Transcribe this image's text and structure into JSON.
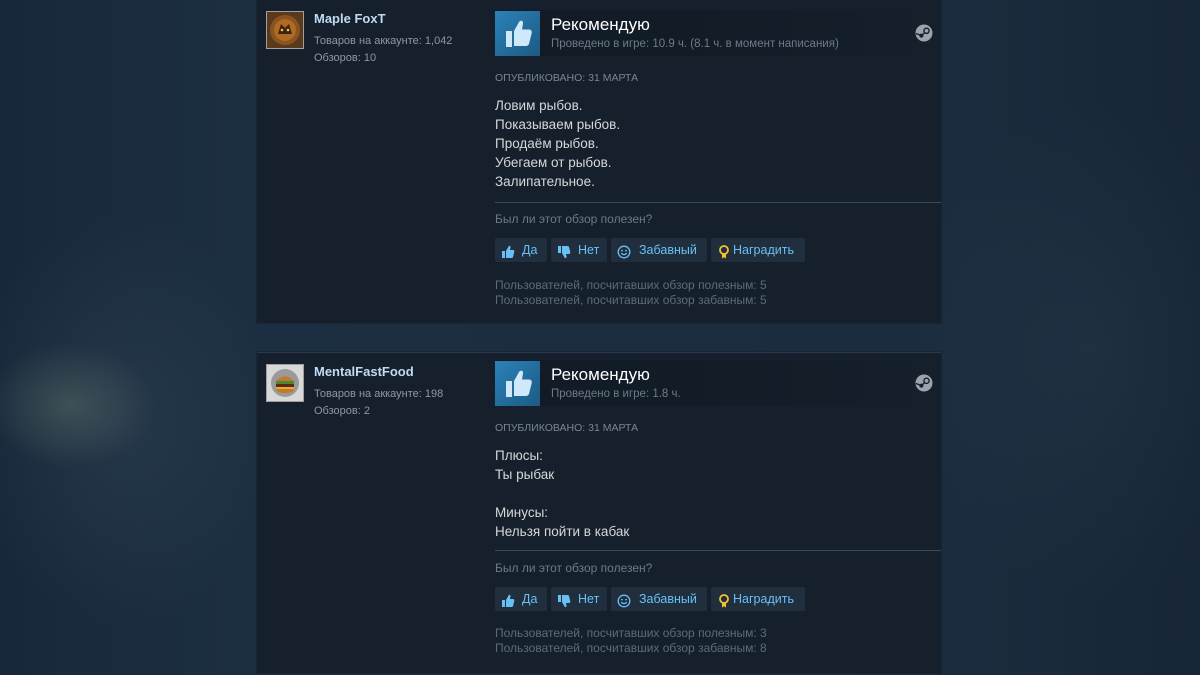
{
  "reviews": [
    {
      "author": {
        "name": "Maple FoxT",
        "products_owned": "Товаров на аккаунте: 1,042",
        "reviews": "Обзоров: 10",
        "avatar": "fox-avatar"
      },
      "recommendation": "Рекомендую",
      "hours": "Проведено в игре: 10.9 ч. (8.1 ч. в момент написания)",
      "posted": "Опубликовано: 31 марта",
      "content_lines": [
        "Ловим рыбов.",
        "Показываем рыбов.",
        "Продаём рыбов.",
        "Убегаем от рыбов.",
        "Залипательное."
      ],
      "helpful_question": "Был ли этот обзор полезен?",
      "buttons": {
        "yes": "Да",
        "no": "Нет",
        "funny": "Забавный",
        "award": "Наградить"
      },
      "stats": {
        "helpful": "Пользователей, посчитавших обзор полезным: 5",
        "funny": "Пользователей, посчитавших обзор забавным: 5"
      }
    },
    {
      "author": {
        "name": "MentalFastFood",
        "products_owned": "Товаров на аккаунте: 198",
        "reviews": "Обзоров: 2",
        "avatar": "burger-avatar"
      },
      "recommendation": "Рекомендую",
      "hours": "Проведено в игре: 1.8 ч.",
      "posted": "Опубликовано: 31 марта",
      "content_lines": [
        "Плюсы:",
        "Ты рыбак",
        "",
        "Минусы:",
        "Нельзя пойти в кабак"
      ],
      "helpful_question": "Был ли этот обзор полезен?",
      "buttons": {
        "yes": "Да",
        "no": "Нет",
        "funny": "Забавный",
        "award": "Наградить"
      },
      "stats": {
        "helpful": "Пользователей, посчитавших обзор полезным: 3",
        "funny": "Пользователей, посчитавших обзор забавным: 8"
      }
    }
  ],
  "icons": {
    "thumb": "thumbs-up-icon",
    "platform": "steam-icon",
    "yes": "thumbs-up-icon",
    "no": "thumbs-down-icon",
    "funny": "smiley-icon",
    "award": "award-icon"
  },
  "colors": {
    "link": "#67c1f5",
    "username": "#c1dbf4",
    "award": "#f2c230",
    "recommend_box": "#2b82b8"
  }
}
